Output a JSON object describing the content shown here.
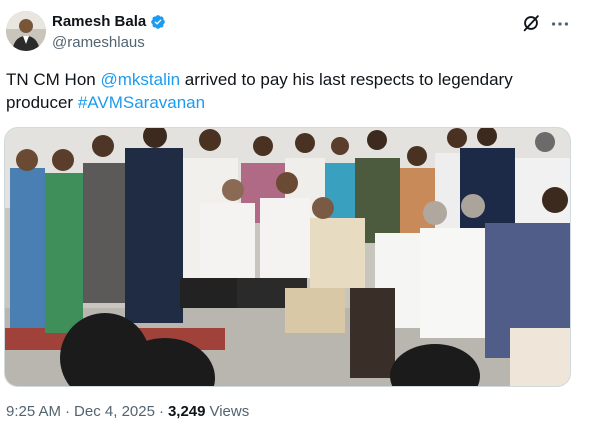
{
  "author": {
    "name": "Ramesh Bala",
    "handle": "@rameshlaus",
    "verified": true
  },
  "tweet": {
    "text_parts": [
      {
        "type": "text",
        "value": "TN CM Hon "
      },
      {
        "type": "mention",
        "value": "@mkstalin"
      },
      {
        "type": "text",
        "value": " arrived to pay his last respects to legendary producer "
      },
      {
        "type": "hashtag",
        "value": "#AVMSaravanan"
      }
    ]
  },
  "meta": {
    "time": "9:25 AM",
    "separator1": "·",
    "date": "Dec 4, 2025",
    "separator2": "·",
    "views_count": "3,249",
    "views_label": "Views"
  },
  "colors": {
    "link": "#1d9bf0",
    "verified_badge": "#1d9bf0",
    "muted_text": "#536471"
  },
  "icons": [
    "verified-badge-icon",
    "grok-icon",
    "more-icon"
  ]
}
